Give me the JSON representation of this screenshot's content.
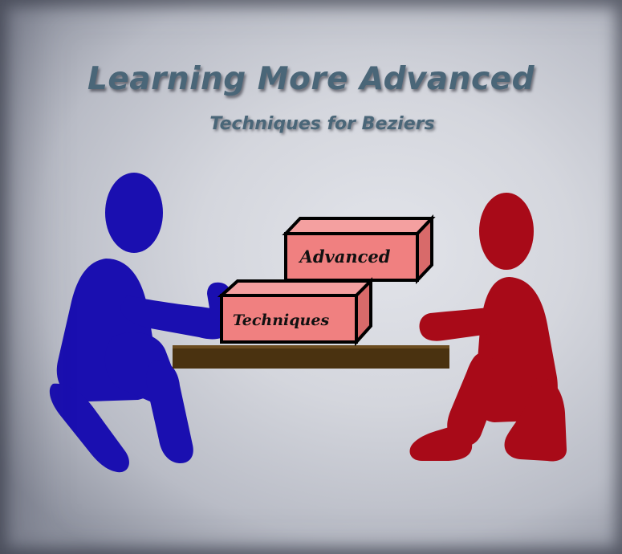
{
  "title": "Learning More Advanced",
  "subtitle": "Techniques for Beziers",
  "boxes": {
    "upper_label": "Advanced",
    "lower_label": "Techniques"
  },
  "colors": {
    "title_text": "#4a6678",
    "left_person": "#1a0fb0",
    "right_person": "#a80a18",
    "box_fill": "#f08080",
    "table_top": "#4a3210"
  },
  "figures": {
    "left": "blue-person-figure",
    "right": "red-person-figure"
  }
}
